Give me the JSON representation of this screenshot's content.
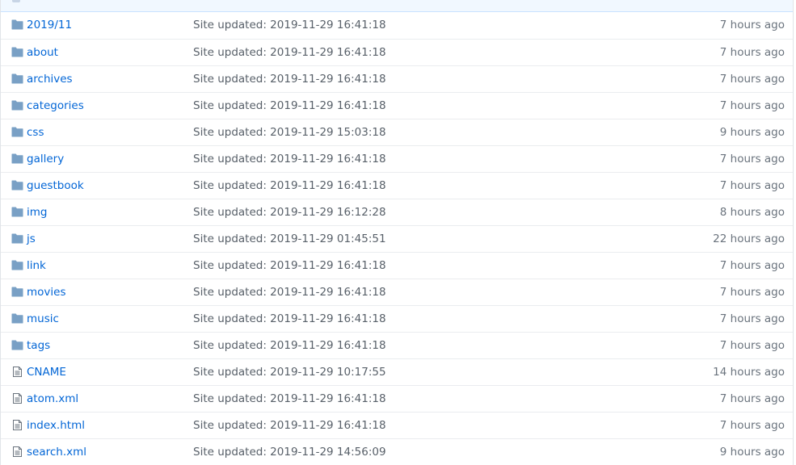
{
  "colors": {
    "link": "#0366d6",
    "folder_icon": "#79a0c5",
    "file_icon": "#6a737d",
    "header_bg": "#f1f8ff"
  },
  "files": [
    {
      "type": "folder",
      "icon": "folder-icon",
      "name": "2019/11",
      "message": "Site updated: 2019-11-29 16:41:18",
      "age": "7 hours ago"
    },
    {
      "type": "folder",
      "icon": "folder-icon",
      "name": "about",
      "message": "Site updated: 2019-11-29 16:41:18",
      "age": "7 hours ago"
    },
    {
      "type": "folder",
      "icon": "folder-icon",
      "name": "archives",
      "message": "Site updated: 2019-11-29 16:41:18",
      "age": "7 hours ago"
    },
    {
      "type": "folder",
      "icon": "folder-icon",
      "name": "categories",
      "message": "Site updated: 2019-11-29 16:41:18",
      "age": "7 hours ago"
    },
    {
      "type": "folder",
      "icon": "folder-icon",
      "name": "css",
      "message": "Site updated: 2019-11-29 15:03:18",
      "age": "9 hours ago"
    },
    {
      "type": "folder",
      "icon": "folder-icon",
      "name": "gallery",
      "message": "Site updated: 2019-11-29 16:41:18",
      "age": "7 hours ago"
    },
    {
      "type": "folder",
      "icon": "folder-icon",
      "name": "guestbook",
      "message": "Site updated: 2019-11-29 16:41:18",
      "age": "7 hours ago"
    },
    {
      "type": "folder",
      "icon": "folder-icon",
      "name": "img",
      "message": "Site updated: 2019-11-29 16:12:28",
      "age": "8 hours ago"
    },
    {
      "type": "folder",
      "icon": "folder-icon",
      "name": "js",
      "message": "Site updated: 2019-11-29 01:45:51",
      "age": "22 hours ago"
    },
    {
      "type": "folder",
      "icon": "folder-icon",
      "name": "link",
      "message": "Site updated: 2019-11-29 16:41:18",
      "age": "7 hours ago"
    },
    {
      "type": "folder",
      "icon": "folder-icon",
      "name": "movies",
      "message": "Site updated: 2019-11-29 16:41:18",
      "age": "7 hours ago"
    },
    {
      "type": "folder",
      "icon": "folder-icon",
      "name": "music",
      "message": "Site updated: 2019-11-29 16:41:18",
      "age": "7 hours ago"
    },
    {
      "type": "folder",
      "icon": "folder-icon",
      "name": "tags",
      "message": "Site updated: 2019-11-29 16:41:18",
      "age": "7 hours ago"
    },
    {
      "type": "file",
      "icon": "file-icon",
      "name": "CNAME",
      "message": "Site updated: 2019-11-29 10:17:55",
      "age": "14 hours ago"
    },
    {
      "type": "file",
      "icon": "file-icon",
      "name": "atom.xml",
      "message": "Site updated: 2019-11-29 16:41:18",
      "age": "7 hours ago"
    },
    {
      "type": "file",
      "icon": "file-icon",
      "name": "index.html",
      "message": "Site updated: 2019-11-29 16:41:18",
      "age": "7 hours ago"
    },
    {
      "type": "file",
      "icon": "file-icon",
      "name": "search.xml",
      "message": "Site updated: 2019-11-29 14:56:09",
      "age": "9 hours ago"
    }
  ]
}
